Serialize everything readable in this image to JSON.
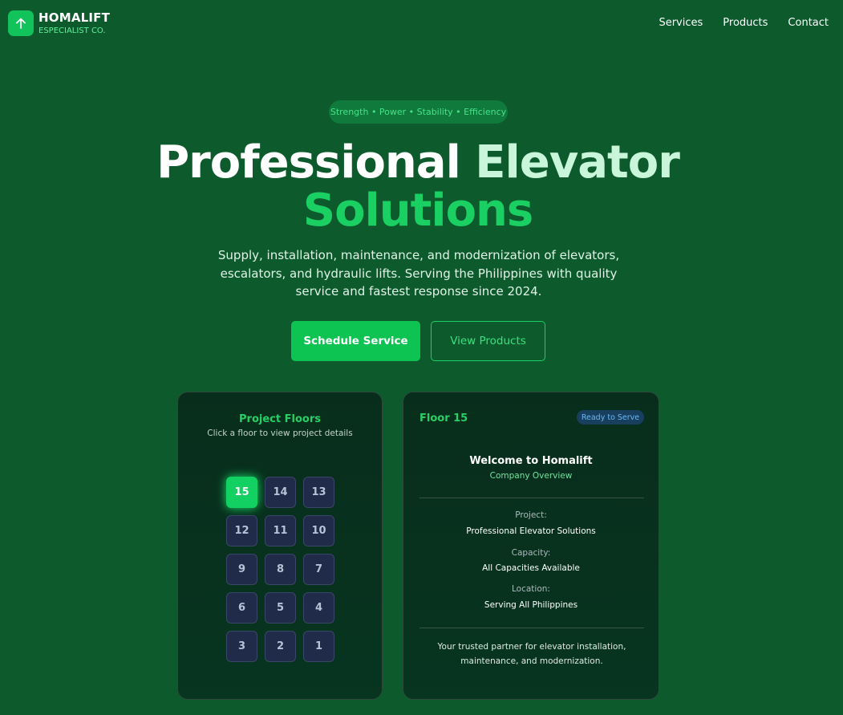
{
  "brand": {
    "name": "HOMALIFT",
    "subtitle": "ESPECIALIST CO.",
    "logo_icon": "arrow-up-icon",
    "accent": "#12c25a"
  },
  "nav": {
    "items": [
      "Services",
      "Products",
      "Contact"
    ]
  },
  "hero": {
    "tagline": "Strength • Power • Stability • Efficiency",
    "title_part1": "Professional",
    "title_part2": "Elevator",
    "title_part3": "Solutions",
    "lead": "Supply, installation, maintenance, and modernization of elevators, escalators, and hydraulic lifts. Serving the Philippines with quality service and fastest response since 2024.",
    "primary_button": "Schedule Service",
    "secondary_button": "View Products"
  },
  "floors_panel": {
    "title": "Project Floors",
    "subtitle": "Click a floor to view project details",
    "floors": [
      "15",
      "14",
      "13",
      "12",
      "11",
      "10",
      "9",
      "8",
      "7",
      "6",
      "5",
      "4",
      "3",
      "2",
      "1"
    ],
    "selected": "15"
  },
  "details_panel": {
    "floor_label": "Floor 15",
    "status_badge": "Ready to Serve",
    "welcome_title": "Welcome to Homalift",
    "welcome_subtitle": "Company Overview",
    "project_label": "Project:",
    "project_value": "Professional Elevator Solutions",
    "capacity_label": "Capacity:",
    "capacity_value": "All Capacities Available",
    "location_label": "Location:",
    "location_value": "Serving All Philippines",
    "footer_line1": "Your trusted partner for elevator installation,",
    "footer_line2": "maintenance, and modernization."
  },
  "colors": {
    "background": "#0d5a2d",
    "accent_green": "#12c25a",
    "floor_button": "#1f2b48",
    "badge_blue": "#6ab6f4"
  }
}
